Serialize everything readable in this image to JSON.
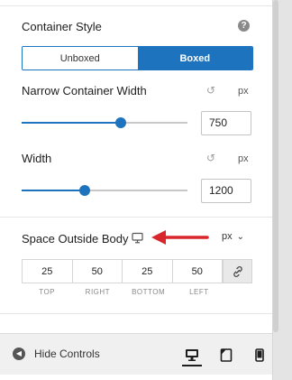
{
  "container_style": {
    "label": "Container Style",
    "help_icon": "?",
    "options": [
      "Unboxed",
      "Boxed"
    ],
    "selected": "Boxed"
  },
  "narrow_width": {
    "label": "Narrow Container Width",
    "unit": "px",
    "value": "750",
    "slider_fraction": 0.6
  },
  "width": {
    "label": "Width",
    "unit": "px",
    "value": "1200",
    "slider_fraction": 0.38
  },
  "space_outside": {
    "label": "Space Outside Body",
    "unit_selected": "px",
    "values": {
      "top": "25",
      "right": "50",
      "bottom": "25",
      "left": "50"
    },
    "sides": [
      "TOP",
      "RIGHT",
      "BOTTOM",
      "LEFT"
    ]
  },
  "footer": {
    "hide_label": "Hide Controls",
    "devices": [
      "desktop-icon",
      "tablet-icon",
      "mobile-icon"
    ],
    "active_device": "desktop"
  },
  "colors": {
    "accent": "#1e73be",
    "arrow": "#d9262c"
  }
}
